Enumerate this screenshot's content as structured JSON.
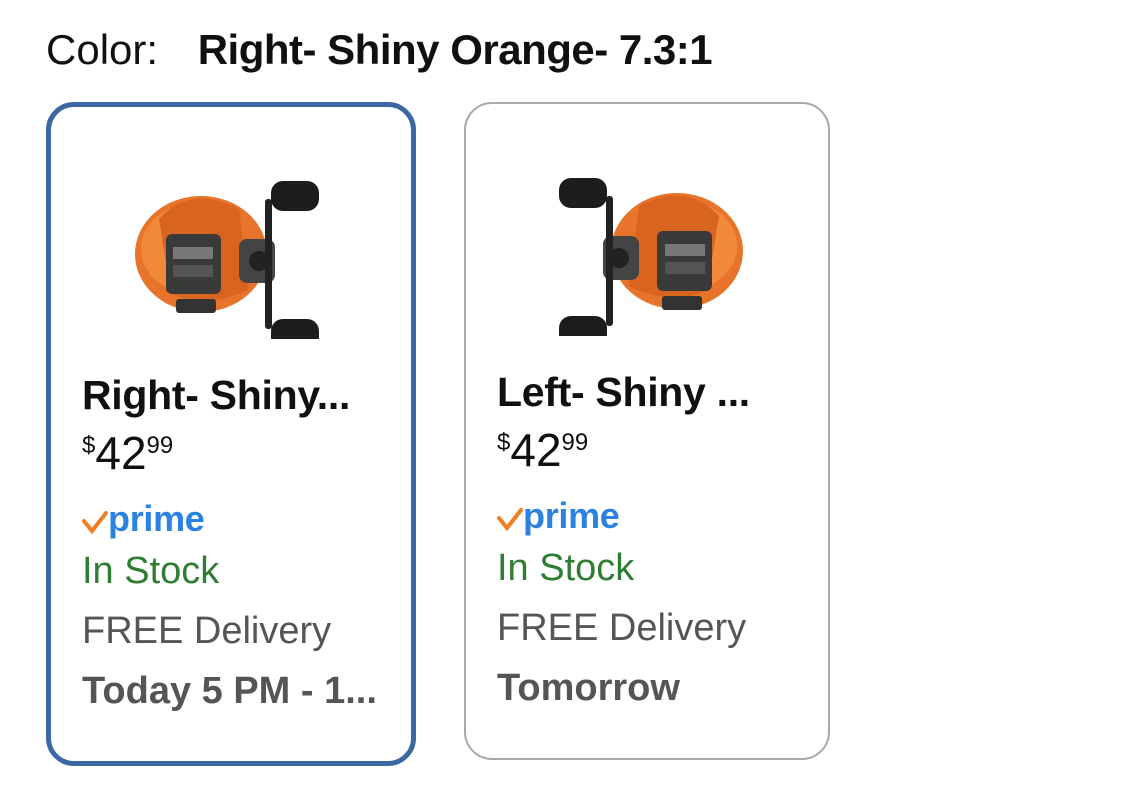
{
  "color_selector": {
    "label": "Color:",
    "selected_value": "Right- Shiny Orange- 7.3:1"
  },
  "options": [
    {
      "title": "Right- Shiny...",
      "price_symbol": "$",
      "price_whole": "42",
      "price_fraction": "99",
      "prime": "prime",
      "stock": "In Stock",
      "delivery": "FREE Delivery",
      "delivery_date": "Today 5 PM - 1...",
      "selected": true,
      "image": "orange-baitcasting-reel-right-handle"
    },
    {
      "title": "Left- Shiny ...",
      "price_symbol": "$",
      "price_whole": "42",
      "price_fraction": "99",
      "prime": "prime",
      "stock": "In Stock",
      "delivery": "FREE Delivery",
      "delivery_date": "Tomorrow",
      "selected": false,
      "image": "orange-baitcasting-reel-left-handle"
    }
  ],
  "colors": {
    "selected_border": "#3b67a3",
    "unselected_border": "#a9a9a9",
    "prime_blue": "#2b82e0",
    "prime_check": "#f07f22",
    "in_stock_green": "#2f7d32",
    "reel_orange": "#e8732a"
  }
}
